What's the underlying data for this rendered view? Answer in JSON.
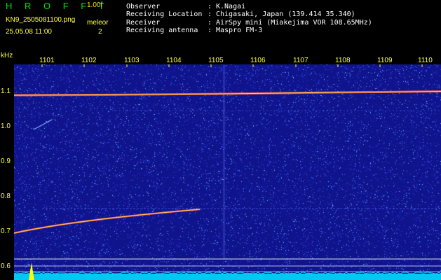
{
  "header": {
    "brand": "H R O F F T",
    "version": "1.00f",
    "filename": "KN9_2505081100.png",
    "date_time": "25.05.08 11:00",
    "mode_label": "meleor",
    "mode_value": "2"
  },
  "info": [
    {
      "label": "Observer",
      "value": "K.Nagai"
    },
    {
      "label": "Receiving Location",
      "value": "Chigasaki, Japan (139.414 35.340)"
    },
    {
      "label": "Receiver",
      "value": "AirSpy mini (Miakejima VOR 108.65MHz)"
    },
    {
      "label": "Receiving antenna",
      "value": "Maspro FM-3"
    }
  ],
  "colon": ":",
  "y_axis": {
    "unit": "kHz",
    "ticks": [
      "1.1",
      "1.0",
      "0.9",
      "0.8",
      "0.7",
      "0.6"
    ]
  },
  "x_axis": {
    "ticks": [
      "1101",
      "1102",
      "1103",
      "1104",
      "1105",
      "1106",
      "1107",
      "1108",
      "1109",
      "1110"
    ]
  },
  "colors": {
    "background": "#000000",
    "brand": "#00e000",
    "axis_text": "#ffff40",
    "info_text": "#ffffff",
    "noise_base": "#10148c",
    "signal": "#ff4040",
    "spectrum_trace": "#00e5ff",
    "spectrum_peak": "#ffff00"
  }
}
